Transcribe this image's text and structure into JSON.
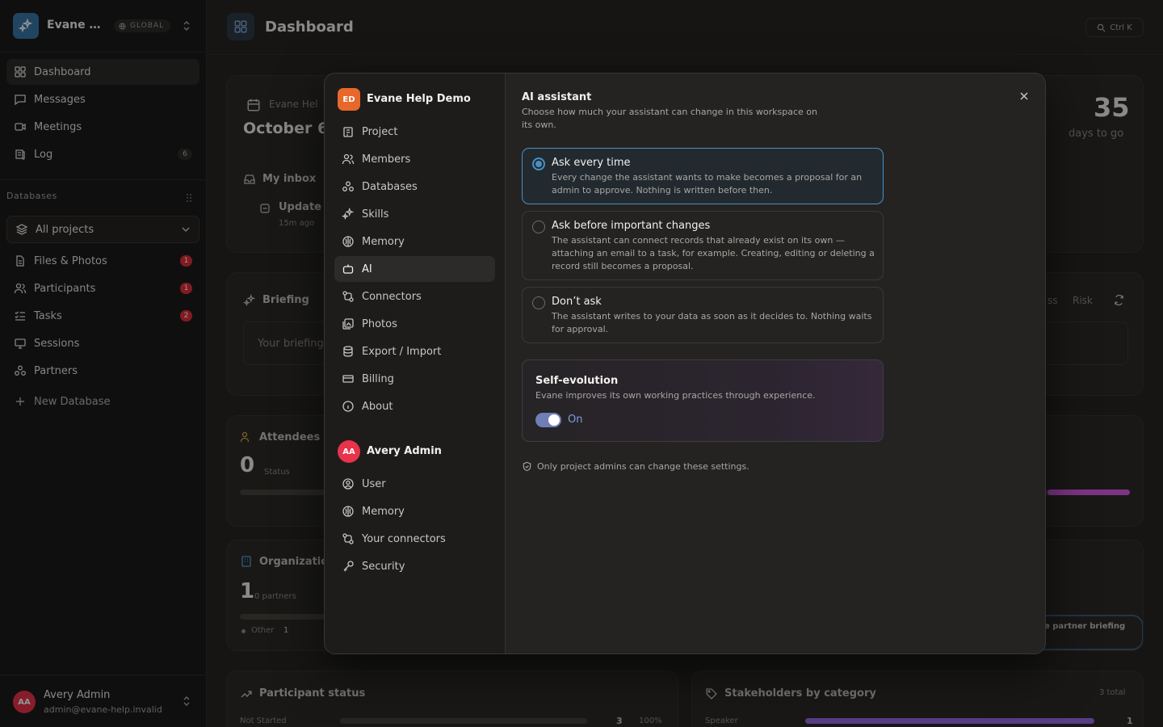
{
  "workspace": {
    "name": "Evane Help Demo",
    "short_name": "Evane He...",
    "badge": "GLOBAL"
  },
  "sidebar": {
    "nav": [
      {
        "label": "Dashboard",
        "icon": "dashboard-icon"
      },
      {
        "label": "Messages",
        "icon": "message-icon"
      },
      {
        "label": "Meetings",
        "icon": "video-icon"
      },
      {
        "label": "Log",
        "icon": "log-icon",
        "count": "6"
      }
    ],
    "databases_label": "Databases",
    "project_select": "All projects",
    "databases": [
      {
        "label": "Files & Photos",
        "badge": "1"
      },
      {
        "label": "Participants",
        "badge": "1"
      },
      {
        "label": "Tasks",
        "badge": "2"
      },
      {
        "label": "Sessions"
      },
      {
        "label": "Partners"
      }
    ],
    "new_database": "New Database",
    "user": {
      "initials": "AA",
      "name": "Avery Admin",
      "email": "admin@evane-help.invalid"
    }
  },
  "main": {
    "title": "Dashboard",
    "shortcut": "Ctrl K",
    "cards": {
      "date_label": "Evane Hel",
      "date_value": "October 6",
      "days_value": "35",
      "days_label": "days to go",
      "inbox": "My inbox",
      "update": "Update",
      "update_time": "15m ago",
      "briefing": "Briefing",
      "briefing_placeholder": "Your briefing",
      "briefing_tab_a": "ss",
      "briefing_tab_b": "Risk",
      "attendees": "Attendees (",
      "attendees_value": "0",
      "attendees_status": "Status",
      "organizations": "Organizatio",
      "org_value": "1",
      "org_partners": "0 partners",
      "org_other": "Other",
      "org_other_count": "1",
      "partner_briefing": "e partner briefing",
      "participant_status": "Participant status",
      "not_started": "Not Started",
      "not_started_count": "3",
      "not_started_pct": "100%",
      "stakeholders": "Stakeholders by category",
      "stakeholders_total": "3 total",
      "speaker": "Speaker",
      "speaker_count": "1"
    }
  },
  "modal": {
    "workspace_initials": "ED",
    "workspace_name": "Evane Help Demo",
    "workspace_items": [
      {
        "label": "Project",
        "icon": "project-icon"
      },
      {
        "label": "Members",
        "icon": "members-icon"
      },
      {
        "label": "Databases",
        "icon": "databases-icon"
      },
      {
        "label": "Skills",
        "icon": "skills-icon"
      },
      {
        "label": "Memory",
        "icon": "memory-icon"
      },
      {
        "label": "AI",
        "icon": "robot-icon",
        "active": true
      },
      {
        "label": "Connectors",
        "icon": "connectors-icon"
      },
      {
        "label": "Photos",
        "icon": "photos-icon"
      },
      {
        "label": "Export / Import",
        "icon": "export-icon"
      },
      {
        "label": "Billing",
        "icon": "billing-icon"
      },
      {
        "label": "About",
        "icon": "info-icon"
      }
    ],
    "user_initials": "AA",
    "user_name": "Avery Admin",
    "user_items": [
      {
        "label": "User",
        "icon": "user-icon"
      },
      {
        "label": "Memory",
        "icon": "memory-icon"
      },
      {
        "label": "Your connectors",
        "icon": "connectors-icon"
      },
      {
        "label": "Security",
        "icon": "key-icon"
      }
    ],
    "title": "AI assistant",
    "subtitle": "Choose how much your assistant can change in this workspace on its own.",
    "options": [
      {
        "title": "Ask every time",
        "desc": "Every change the assistant wants to make becomes a proposal for an admin to approve. Nothing is written before then.",
        "selected": true
      },
      {
        "title": "Ask before important changes",
        "desc": "The assistant can connect records that already exist on its own — attaching an email to a task, for example. Creating, editing or deleting a record still becomes a proposal.",
        "selected": false
      },
      {
        "title": "Don’t ask",
        "desc": "The assistant writes to your data as soon as it decides to. Nothing waits for approval.",
        "selected": false
      }
    ],
    "self_evolution": {
      "title": "Self-evolution",
      "desc": "Evane improves its own working practices through experience.",
      "state": "On"
    },
    "admin_note": "Only project admins can change these settings.",
    "colors": {
      "accent": "#4a8fc4",
      "toggle": "#6f7fb5",
      "danger": "#e02f3a"
    }
  }
}
